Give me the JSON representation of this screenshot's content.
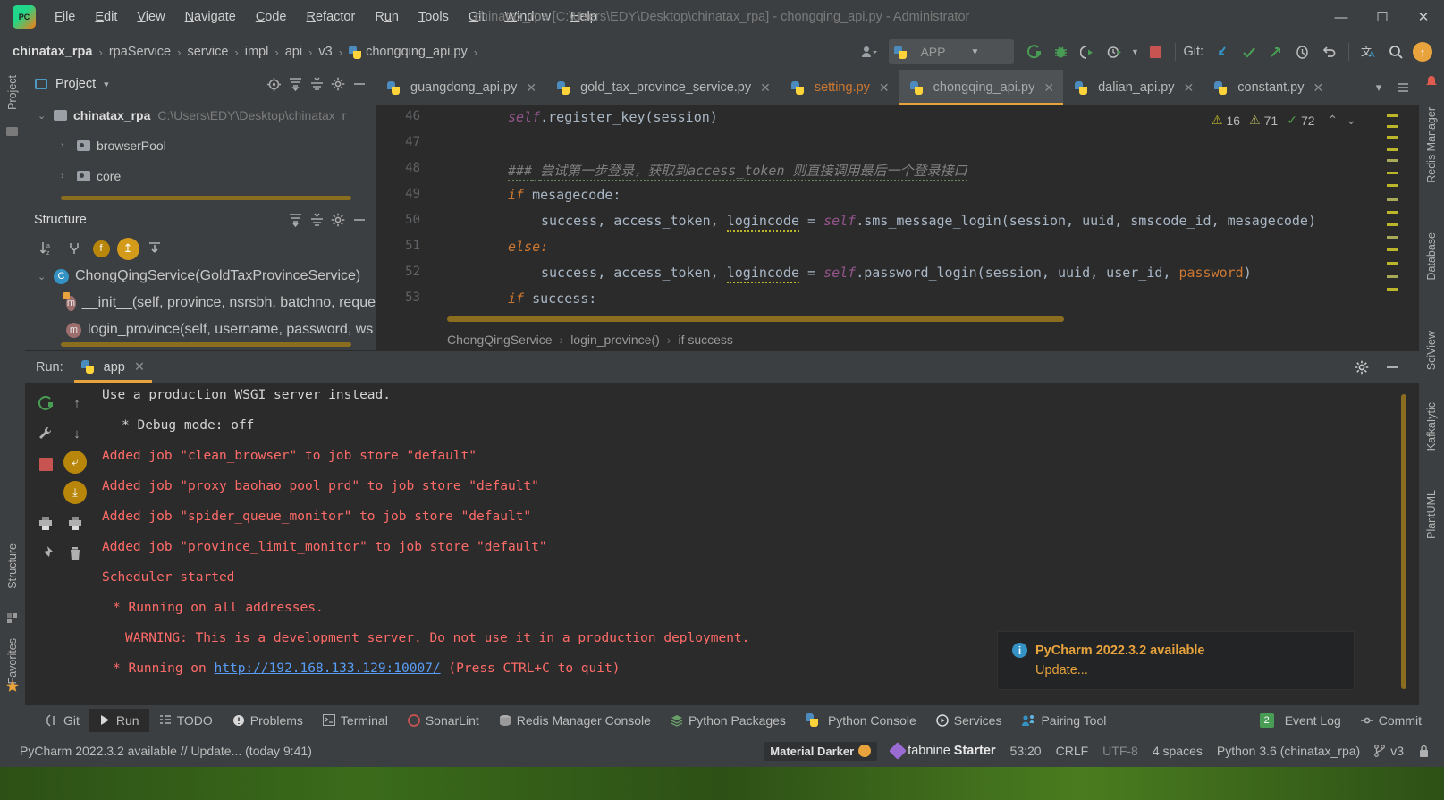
{
  "titlebar": {
    "app_icon": "pycharm-logo",
    "window_title": "chinatax_rpa [C:\\Users\\EDY\\Desktop\\chinatax_rpa] - chongqing_api.py - Administrator",
    "menus": [
      "File",
      "Edit",
      "View",
      "Navigate",
      "Code",
      "Refactor",
      "Run",
      "Tools",
      "Git",
      "Window",
      "Help"
    ],
    "controls": {
      "minimize": "—",
      "maximize": "☐",
      "close": "✕"
    }
  },
  "breadcrumb": {
    "items": [
      "chinatax_rpa",
      "rpaService",
      "service",
      "impl",
      "api",
      "v3",
      "chongqing_api.py"
    ],
    "separator": "›"
  },
  "toolbar": {
    "profile_icon": "user-profile-icon",
    "run_config_name": "APP",
    "run_config_icon": "python-config-icon",
    "dropdown_caret": "▼",
    "run_icon": "run-icon",
    "debug_icon": "debug-icon",
    "run_coverage_icon": "run-with-coverage-icon",
    "profiler_icon": "profiler-icon",
    "stop_icon": "stop-icon",
    "git_label": "Git:",
    "update_project_icon": "update-project-icon",
    "commit_icon": "commit-checkmark-icon",
    "push_icon": "push-arrow-icon",
    "history_icon": "history-clock-icon",
    "rollback_icon": "rollback-icon",
    "translate_icon": "translate-icon",
    "search_icon": "search-everywhere-icon",
    "updates_icon": "update-available-icon"
  },
  "left_stripe": {
    "top_items": [
      "Project"
    ],
    "bottom_items": [
      "Structure",
      "Favorites"
    ],
    "bookmark_icon": "bookmark-star-icon",
    "commit_icon": "commit-icon",
    "pull_requests_icon": "pull-requests-icon"
  },
  "right_stripe": {
    "items": [
      "Redis Manager",
      "Database",
      "SciView",
      "KafkaIytic",
      "PlantUML"
    ],
    "notification_icon": "notification-bell-icon"
  },
  "project_panel": {
    "title": "Project",
    "dropdown_caret": "▾",
    "locate_icon": "locate-file-icon",
    "expand_icon": "expand-all-icon",
    "collapse_icon": "collapse-all-icon",
    "settings_icon": "gear-icon",
    "hide_icon": "hide-panel-icon",
    "tree": [
      {
        "label": "chinatax_rpa",
        "path": "C:\\Users\\EDY\\Desktop\\chinatax_r",
        "expanded": true,
        "depth": 0,
        "arrow": "⌄",
        "bold": true
      },
      {
        "label": "browserPool",
        "path": "",
        "expanded": false,
        "depth": 1,
        "arrow": "›",
        "bold": false
      },
      {
        "label": "core",
        "path": "",
        "expanded": false,
        "depth": 1,
        "arrow": "›",
        "bold": false
      }
    ]
  },
  "structure_panel": {
    "title": "Structure",
    "expand_icon": "expand-all-icon",
    "collapse_icon": "collapse-all-icon",
    "settings_icon": "gear-icon",
    "hide_icon": "hide-panel-icon",
    "toolbar_icons": [
      "sort-alphabetically-icon",
      "show-inherited-icon",
      "show-fields-icon",
      "show-non-public-icon",
      "scroll-from-source-icon"
    ],
    "sort_label": "↓",
    "sort_sub": "az",
    "items": [
      {
        "label": "ChongQingService(GoldTaxProvinceService)",
        "kind": "class",
        "depth": 0,
        "arrow": "⌄"
      },
      {
        "label": "__init__(self, province, nsrsbh, batchno, reque",
        "kind": "method",
        "depth": 1,
        "arrow": ""
      },
      {
        "label": "login_province(self, username, password, ws",
        "kind": "method",
        "depth": 1,
        "arrow": ""
      }
    ]
  },
  "editor": {
    "tabs": [
      {
        "label": "guangdong_api.py",
        "active": false,
        "modified": false,
        "close": "✕"
      },
      {
        "label": "gold_tax_province_service.py",
        "active": false,
        "modified": false,
        "close": "✕"
      },
      {
        "label": "setting.py",
        "active": false,
        "modified": true,
        "close": "✕"
      },
      {
        "label": "chongqing_api.py",
        "active": true,
        "modified": false,
        "close": "✕"
      },
      {
        "label": "dalian_api.py",
        "active": false,
        "modified": false,
        "close": "✕"
      },
      {
        "label": "constant.py",
        "active": false,
        "modified": false,
        "close": "✕"
      }
    ],
    "tab_chevron_icon": "chevron-down-icon",
    "tab_list_icon": "tab-list-icon",
    "inspections": {
      "warning_count": "16",
      "weak_warning_count": "71",
      "ok_count": "72",
      "warning_icon": "warning-triangle-icon",
      "weak_warning_icon": "weak-warning-triangle-icon",
      "ok_icon": "checkmark-icon",
      "up_arrow": "⌃",
      "down_arrow": "⌄"
    },
    "lines": [
      {
        "no": "46",
        "text": "self.register_key(session)"
      },
      {
        "no": "47",
        "text": ""
      },
      {
        "no": "48",
        "text": "### 尝试第一步登录，获取到access_token 则直接调用最后一个登录接口"
      },
      {
        "no": "49",
        "text": "if mesagecode:"
      },
      {
        "no": "50",
        "text": "success, access_token, logincode = self.sms_message_login(session, uuid, smscode_id, mesagecode)"
      },
      {
        "no": "51",
        "text": "else:"
      },
      {
        "no": "52",
        "text": "success, access_token, logincode = self.password_login(session, uuid, user_id, password)"
      },
      {
        "no": "53",
        "text": "if success:"
      }
    ],
    "code_tokens": {
      "l46_self": "self",
      "l46_rest": ".register_key(session)",
      "l48_hash": "###",
      "l48_comment": "尝试第一步登录，获取到access_token 则直接调用最后一个登录接口",
      "l49_if": "if",
      "l49_cond": " mesagecode:",
      "l50_vars": "success, access_token, ",
      "l50_logincode": "logincode",
      "l50_eq": " = ",
      "l50_self": "self",
      "l50_call": ".sms_message_login(session, uuid, smscode_id, mesagecode)",
      "l51_else": "else:",
      "l52_vars": "success, access_token, ",
      "l52_logincode": "logincode",
      "l52_eq": " = ",
      "l52_self": "self",
      "l52_call": ".password_login(session, uuid, user_id, ",
      "l52_password": "password",
      "l52_end": ")",
      "l53_if": "if",
      "l53_cond": " success:"
    },
    "breadcrumb_bottom": [
      "ChongQingService",
      "login_province()",
      "if success"
    ],
    "breadcrumb_bottom_sep": "›"
  },
  "run_panel": {
    "run_label": "Run:",
    "tab_label": "app",
    "tab_icon": "python-icon",
    "tab_close": "✕",
    "settings_icon": "gear-icon",
    "hide_icon": "hide-panel-icon",
    "side_icons": [
      "rerun-icon",
      "up-arrow-icon",
      "wrench-icon",
      "down-arrow-icon",
      "stop-icon",
      "soft-wrap-icon",
      "scroll-to-end-icon",
      "print-icon",
      "pin-icon",
      "trash-icon"
    ],
    "console_lines": [
      {
        "text": "Use a production WSGI server instead.",
        "color": "white"
      },
      {
        "text": "* Debug mode: off",
        "color": "white"
      },
      {
        "text": "Added job \"clean_browser\" to job store \"default\"",
        "color": "red"
      },
      {
        "text": "Added job \"proxy_baohao_pool_prd\" to job store \"default\"",
        "color": "red"
      },
      {
        "text": "Added job \"spider_queue_monitor\" to job store \"default\"",
        "color": "red"
      },
      {
        "text": "Added job \"province_limit_monitor\" to job store \"default\"",
        "color": "red"
      },
      {
        "text": "Scheduler started",
        "color": "red"
      },
      {
        "text": "* Running on all addresses.",
        "color": "red"
      },
      {
        "text": "WARNING: This is a development server. Do not use it in a production deployment.",
        "color": "red"
      }
    ],
    "last_line": {
      "prefix": "* Running on ",
      "link": "http://192.168.133.129:10007/",
      "suffix": " (Press CTRL+C to quit)"
    }
  },
  "notification": {
    "icon": "info-icon",
    "title": "PyCharm 2022.3.2 available",
    "action": "Update..."
  },
  "tool_window_bar": {
    "items": [
      {
        "label": "Git",
        "icon": "git-icon",
        "active": false
      },
      {
        "label": "Run",
        "icon": "run-triangle-icon",
        "active": true
      },
      {
        "label": "TODO",
        "icon": "todo-list-icon",
        "active": false
      },
      {
        "label": "Problems",
        "icon": "problems-icon",
        "active": false
      },
      {
        "label": "Terminal",
        "icon": "terminal-icon",
        "active": false
      },
      {
        "label": "SonarLint",
        "icon": "sonarlint-icon",
        "active": false
      },
      {
        "label": "Redis Manager Console",
        "icon": "redis-icon",
        "active": false
      },
      {
        "label": "Python Packages",
        "icon": "packages-icon",
        "active": false
      },
      {
        "label": "Python Console",
        "icon": "python-console-icon",
        "active": false
      },
      {
        "label": "Services",
        "icon": "services-icon",
        "active": false
      },
      {
        "label": "Pairing Tool",
        "icon": "pairing-tool-icon",
        "active": false
      }
    ],
    "right_items": [
      {
        "label": "Event Log",
        "badge": "2",
        "icon": "event-log-icon"
      },
      {
        "label": "Commit",
        "badge": "",
        "icon": "commit-icon"
      }
    ]
  },
  "statusbar": {
    "message": "PyCharm 2022.3.2 available // Update... (today 9:41)",
    "theme": "Material Darker",
    "tabnine_brand": "tabnine",
    "tabnine_plan": "Starter",
    "caret_position": "53:20",
    "line_separator": "CRLF",
    "encoding": "UTF-8",
    "indent": "4 spaces",
    "interpreter": "Python 3.6 (chinatax_rpa)",
    "branch": "v3",
    "branch_icon": "git-branch-icon",
    "lock_icon": "lock-icon"
  },
  "colors": {
    "accent_orange": "#e8a33d",
    "console_red": "#ff6b68",
    "link_blue": "#589df6",
    "panel_bg": "#3c3f41",
    "editor_bg": "#2b2b2b"
  }
}
